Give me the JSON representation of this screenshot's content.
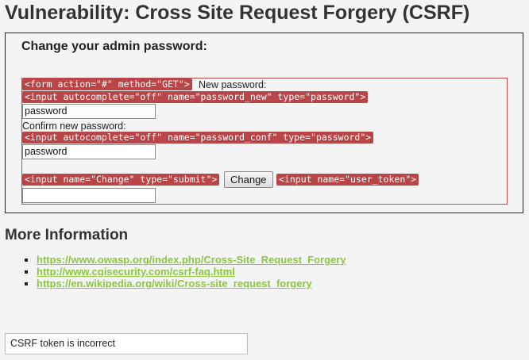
{
  "page": {
    "title": "Vulnerability: Cross Site Request Forgery (CSRF)"
  },
  "panel": {
    "heading": "Change your admin password:"
  },
  "form": {
    "form_tag": "<form action=\"#\" method=\"GET\">",
    "new_password_label": "New password:",
    "new_password_tag": "<input autocomplete=\"off\" name=\"password_new\" type=\"password\">",
    "new_password_value": "password",
    "confirm_label": "Confirm new password:",
    "confirm_tag": "<input autocomplete=\"off\" name=\"password_conf\" type=\"password\">",
    "confirm_value": "password",
    "submit_tag": "<input name=\"Change\" type=\"submit\">",
    "submit_label": "Change",
    "token_tag": "<input name=\"user_token\">",
    "token_value": ""
  },
  "more_info": {
    "title": "More Information",
    "links": [
      "https://www.owasp.org/index.php/Cross-Site_Request_Forgery",
      "http://www.cgisecurity.com/csrf-faq.html",
      "https://en.wikipedia.org/wiki/Cross-site_request_forgery"
    ]
  },
  "status": {
    "message": "CSRF token is incorrect"
  },
  "colors": {
    "tag_background": "#b84547",
    "link": "#8cc63f",
    "form_border": "#c0494b"
  }
}
